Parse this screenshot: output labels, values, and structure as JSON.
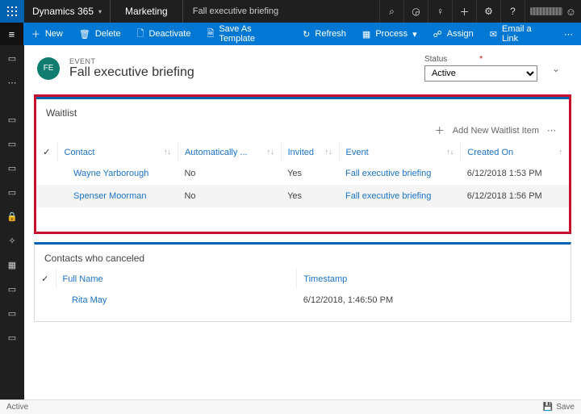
{
  "top": {
    "brand": "Dynamics 365",
    "area": "Marketing",
    "crumb": "Fall executive briefing"
  },
  "topicons": [
    "search",
    "task",
    "bulb",
    "plus",
    "gear",
    "help"
  ],
  "commands": {
    "new": "New",
    "delete": "Delete",
    "deactivate": "Deactivate",
    "save_as_template": "Save As Template",
    "refresh": "Refresh",
    "process": "Process",
    "assign": "Assign",
    "email_link": "Email a Link"
  },
  "header": {
    "avatar": "FE",
    "type": "EVENT",
    "name": "Fall executive briefing",
    "status_label": "Status",
    "status_value": "Active"
  },
  "waitlist": {
    "title": "Waitlist",
    "add_label": "Add New Waitlist Item",
    "cols": {
      "contact": "Contact",
      "auto": "Automatically ...",
      "invited": "Invited",
      "event": "Event",
      "created": "Created On"
    },
    "rows": [
      {
        "contact": "Wayne Yarborough",
        "auto": "No",
        "invited": "Yes",
        "event": "Fall executive briefing",
        "created": "6/12/2018 1:53 PM"
      },
      {
        "contact": "Spenser Moorman",
        "auto": "No",
        "invited": "Yes",
        "event": "Fall executive briefing",
        "created": "6/12/2018 1:56 PM"
      }
    ]
  },
  "canceled": {
    "title": "Contacts who canceled",
    "cols": {
      "name": "Full Name",
      "ts": "Timestamp"
    },
    "rows": [
      {
        "name": "Rita May",
        "ts": "6/12/2018, 1:46:50 PM"
      }
    ]
  },
  "statusbar": {
    "state": "Active",
    "save": "Save"
  }
}
